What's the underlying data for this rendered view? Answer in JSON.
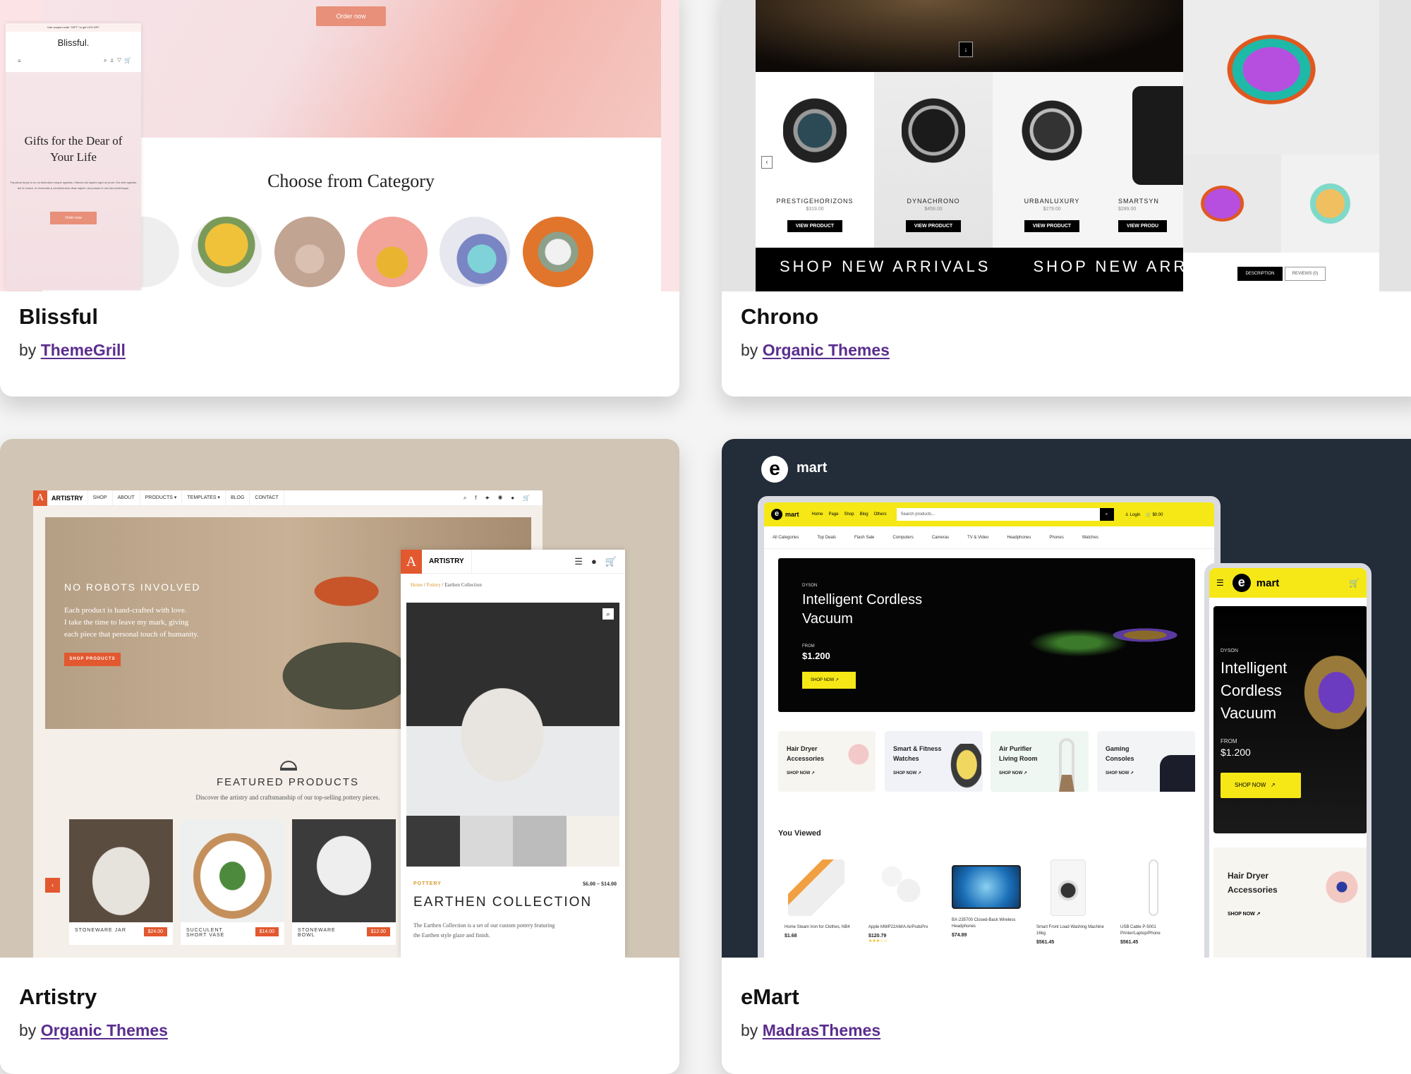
{
  "cards": [
    {
      "title": "Blissful",
      "by": "by",
      "author": "ThemeGrill",
      "preview": {
        "order_button": "Order now",
        "coupon": "Use coupon code \"GIFT\" to get 10% OFF",
        "logo": "Blissful.",
        "cart_count": "0",
        "hero_title": "Gifts for the Dear of Your Life",
        "hero_text": "Faucibus turpis in eu mi bibendum neque egestas. Ultrices dui sapien eget mi proin. Est velit egestas dui id ornare. Id venenatis a condimentum vitae sapien. Accumsan in nisl nisi scelerisque.",
        "mobile_order_button": "Order now",
        "section_title": "Choose from Category"
      }
    },
    {
      "title": "Chrono",
      "by": "by",
      "author": "Organic Themes",
      "preview": {
        "products": [
          {
            "name": "PRESTIGEHORIZONS",
            "price": "$319.00",
            "button": "VIEW PRODUCT"
          },
          {
            "name": "DYNACHRONO",
            "price": "$459.00",
            "button": "VIEW PRODUCT"
          },
          {
            "name": "URBANLUXURY",
            "price": "$279.00",
            "button": "VIEW PRODUCT"
          },
          {
            "name": "SMARTSYN",
            "price": "$289.00",
            "button": "VIEW PRODU"
          }
        ],
        "banner": [
          "SHOP NEW ARRIVALS",
          "SHOP NEW ARRIVA"
        ],
        "tabs": [
          "DESCRIPTION",
          "REVIEWS (0)"
        ]
      }
    },
    {
      "title": "Artistry",
      "by": "by",
      "author": "Organic Themes",
      "preview": {
        "logo": "ARTISTRY",
        "nav": [
          "SHOP",
          "ABOUT",
          "PRODUCTS ▾",
          "TEMPLATES ▾",
          "BLOG",
          "CONTACT"
        ],
        "hero_kicker": "NO ROBOTS INVOLVED",
        "hero_text": [
          "Each product is hand-crafted with love.",
          "I take the time to leave my mark, giving",
          "each piece that personal touch of humanity."
        ],
        "hero_button": "SHOP PRODUCTS",
        "featured_title": "FEATURED PRODUCTS",
        "featured_sub": "Discover the artistry and craftsmanship of our top-selling pottery pieces.",
        "products": [
          {
            "name": "STONEWARE JAR",
            "price": "$24.00"
          },
          {
            "name": "SUCCULENT SHORT VASE",
            "price": "$14.00"
          },
          {
            "name": "STONEWARE BOWL",
            "price": "$12.00"
          }
        ],
        "breadcrumb": [
          "Home",
          "Pottery",
          "Earthen Collection"
        ],
        "product_category": "POTTERY",
        "product_price": "$6.00 – $14.00",
        "product_title": "EARTHEN COLLECTION",
        "product_desc": "The Earthen Collection is a set of our custom pottery featuring the Earthen style glaze and finish."
      }
    },
    {
      "title": "eMart",
      "by": "by",
      "author": "MadrasThemes",
      "preview": {
        "logo_letter": "e",
        "logo_text": "mart",
        "nav": [
          "Home",
          "Page",
          "Shop",
          "Blog",
          "Others"
        ],
        "search_placeholder": "Search products...",
        "login": "Login",
        "cart_total": "$0.00",
        "categories": [
          "All Categories",
          "Top Deals",
          "Flash Sale",
          "Computers",
          "Cameras",
          "TV & Video",
          "Headphones",
          "Phones",
          "Watches"
        ],
        "hero_brand": "DYSON",
        "hero_title": "Intelligent Cordless Vacuum",
        "hero_from": "FROM",
        "hero_price": "$1.200",
        "hero_button": "SHOP NOW",
        "cat_cards": [
          {
            "title": "Hair Dryer Accessories",
            "link": "SHOP NOW"
          },
          {
            "title": "Smart & Fitness Watches",
            "link": "SHOP NOW"
          },
          {
            "title": "Air Purifier Living Room",
            "link": "SHOP NOW"
          },
          {
            "title": "Gaming Consoles",
            "link": "SHOP NOW"
          }
        ],
        "viewed_title": "You Viewed",
        "viewed": [
          {
            "name": "Home Steam Iron for Clothes, NB4",
            "price": "$1.68"
          },
          {
            "name": "Apple MWP22AM/A AirPodsPro",
            "price": "$120.79",
            "rating": 3
          },
          {
            "name": "BX-235700 Closed-Back Wireless Headphones",
            "price": "$74.89"
          },
          {
            "name": "Smart Front Load Washing Machine 16kg",
            "price": "$561.45"
          },
          {
            "name": "USB Cable P-5001 Printer/Laptop/Phone",
            "price": "$561.45"
          }
        ],
        "mobile_cat": {
          "title": "Hair Dryer Accessories",
          "link": "SHOP NOW"
        }
      }
    }
  ],
  "colors": {
    "link": "#5b2d8f",
    "emart_yellow": "#f5e816",
    "artistry_orange": "#e2582f",
    "blissful_pink": "#e8907a"
  }
}
